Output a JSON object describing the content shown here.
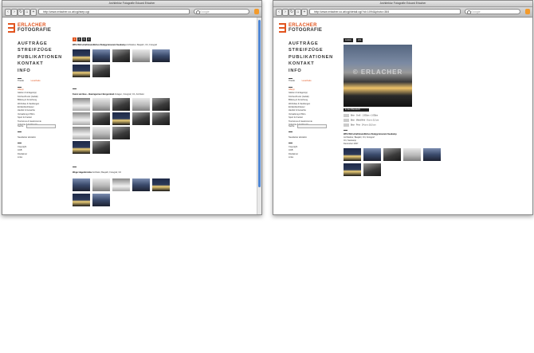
{
  "left_window": {
    "title": "Architektur Fotografie Eduard Erlacher",
    "url": "http://www.erlacher.co.at/cgi/step.cgi",
    "search_placeholder": "Google",
    "logo": {
      "line1": "ERLACHER",
      "line2": "FOTOGRAFIE"
    },
    "nav_big": [
      "AUFTRÄGE",
      "STREIFZÜGE",
      "PUBLIKATIONEN",
      "KONTAKT",
      "INFO"
    ],
    "filter_links": {
      "first": "Theide",
      "second": "Lesetheke"
    },
    "sidebar_active": "Alle(a)",
    "sidebar_items": [
      "Gärten & Anlagen(a)",
      "Kirchen/Kunst (Gebät)",
      "Bildung & Forschung",
      "Wohnbau & Siedlungen",
      "Einfamilienhäuser",
      "Handel & Gewerbe",
      "Verwaltung & Büro",
      "Sport & Freizeit",
      "Tourismus & Gastronomie",
      "Industrie & Kraftwerke"
    ],
    "search_label": "Suche",
    "after_search": [
      "Newsletter abo/abm"
    ],
    "bottom_links": [
      "Copyright",
      "AGB",
      "Disclaimer",
      "Links"
    ],
    "pager": [
      "1",
      "2",
      "3",
      "4"
    ],
    "sections": [
      {
        "caption_bold": "WiSi Wirtschaftskundliches Realgymnasium Seekamp",
        "caption_rest": "Architektur, Baujahr, Ort, Fotograf"
      },
      {
        "caption_bold": "Kunst am Bau – Bauingenieur Burgenland",
        "caption_rest": "Anlagen, Fotograf, Ort, Architekt"
      },
      {
        "caption_bold": "Wege Hagenbrücke",
        "caption_rest": "Architekt, Baujahr, Fotograf, Ort"
      }
    ]
  },
  "right_window": {
    "title": "Architektur Fotografie Eduard Erlacher",
    "url": "http://www.erlacher.co.at/cgi/detail.cgi?id=1094&photo=384",
    "search_placeholder": "Google",
    "logo": {
      "line1": "ERLACHER",
      "line2": "FOTOGRAFIE"
    },
    "nav_big": [
      "AUFTRÄGE",
      "STREIFZÜGE",
      "PUBLIKATIONEN",
      "KONTAKT",
      "INFO"
    ],
    "filter_links": {
      "first": "Theide",
      "second": "Lesetheke"
    },
    "sidebar_active": "Alle(a)",
    "sidebar_items": [
      "Gärten & Anlagen(a)",
      "Kirchen/Kunst (Gebät)",
      "Bildung & Forschung",
      "Wohnbau & Siedlungen",
      "Einfamilienhäuser",
      "Handel & Gewerbe",
      "Verwaltung & Büro",
      "Sport & Freizeit",
      "Tourismus & Gastronomie",
      "Industrie & Kraftwerke"
    ],
    "search_label": "Suche",
    "after_search": [
      "Newsletter abo/abm"
    ],
    "bottom_links": [
      "Copyright",
      "AGB",
      "Disclaimer",
      "Links"
    ],
    "top_buttons": [
      "zurück",
      "info"
    ],
    "watermark": "© ERLACHER",
    "info_header": "In den Warenkorb",
    "info_rows": [
      "Bitte · Groß · 1.500px x 1.000px",
      "Bitte · Mittel/Web · 8 cm x 5,3 cm",
      "Bitte · Print · 24 cm x 16,0 cm"
    ],
    "detail_title": "WiSi Wirtschaftskundliches Realgymnasium Seekamp",
    "detail_lines": [
      "Architektur, Baujahr, Ort, Fotograf",
      "Ort, Seekamp",
      "Dezember 2007"
    ]
  }
}
